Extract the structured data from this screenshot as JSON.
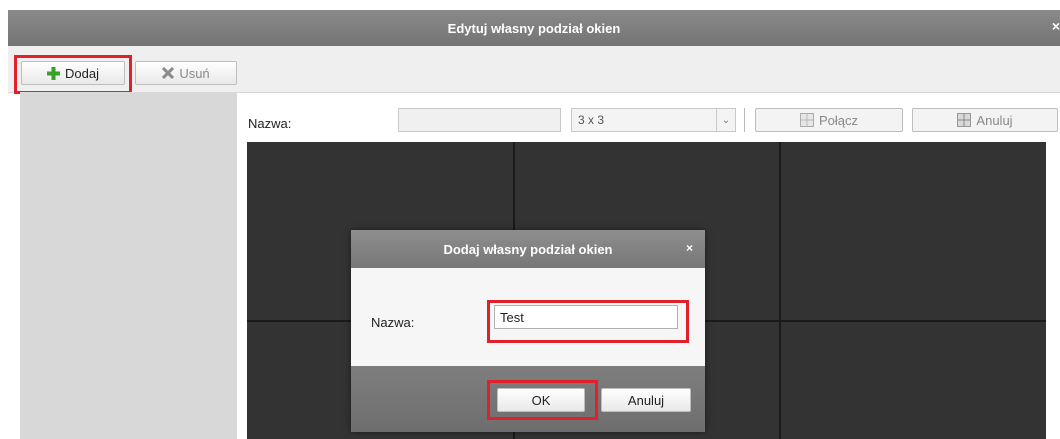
{
  "window": {
    "title": "Edytuj własny podział okien",
    "close_glyph": "×"
  },
  "toolbar": {
    "add_label": "Dodaj",
    "delete_label": "Usuń"
  },
  "form": {
    "name_label": "Nazwa:",
    "name_value": "",
    "layout_value": "3 x 3",
    "merge_label": "Połącz",
    "cancel_label": "Anuluj"
  },
  "dialog": {
    "title": "Dodaj własny podział okien",
    "close_glyph": "×",
    "name_label": "Nazwa:",
    "name_value": "Test",
    "ok_label": "OK",
    "cancel_label": "Anuluj"
  },
  "colors": {
    "highlight": "#e0202a",
    "add_icon": "#3aa02a",
    "titlebar": "#7d7d7d"
  },
  "icons": [
    "plus-icon",
    "x-icon",
    "merge-icon",
    "cancel-grid-icon",
    "chevron-down-icon",
    "close-icon"
  ]
}
